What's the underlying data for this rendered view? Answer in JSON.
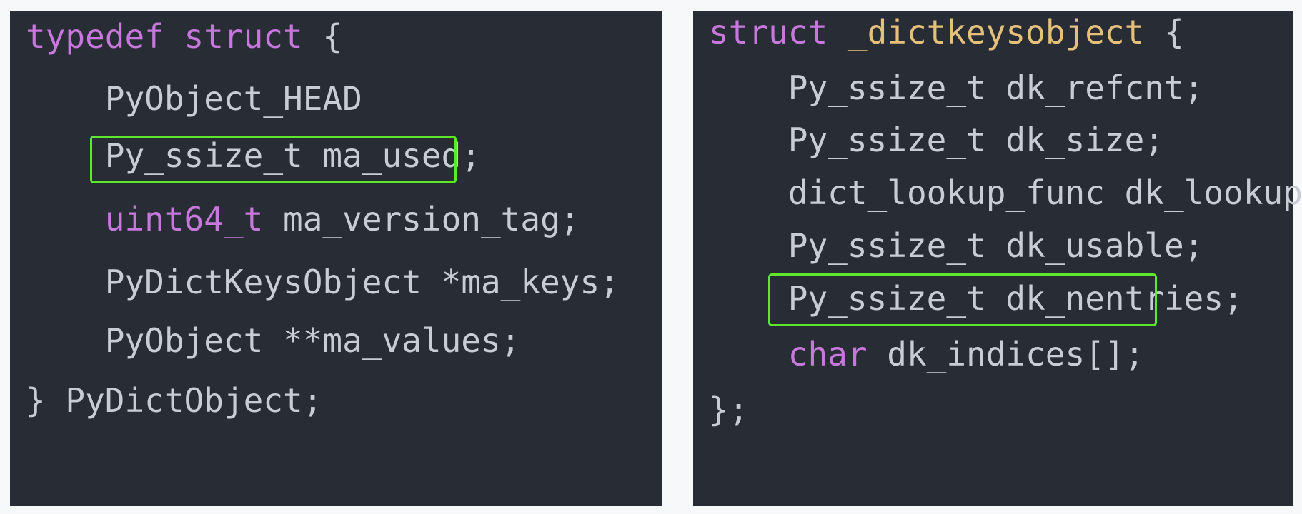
{
  "colors": {
    "page_background": "#f6f8fa",
    "panel_background": "#282c34",
    "keyword": "#c678dd",
    "struct_name": "#e5c07b",
    "plain_text": "#c8ccd4",
    "highlight_border": "#5ee82c"
  },
  "left_panel": {
    "lines": [
      {
        "tokens": [
          {
            "t": "typedef struct",
            "c": "kw"
          },
          {
            "t": " {",
            "c": "plain"
          }
        ]
      },
      {
        "tokens": [
          {
            "t": "    PyObject_HEAD",
            "c": "plain"
          }
        ]
      },
      {
        "tokens": [
          {
            "t": "    Py_ssize_t ma_used;",
            "c": "plain"
          }
        ],
        "highlighted": true
      },
      {
        "tokens": [
          {
            "t": "    ",
            "c": "plain"
          },
          {
            "t": "uint64_t",
            "c": "kw"
          },
          {
            "t": " ma_version_tag;",
            "c": "plain"
          }
        ]
      },
      {
        "tokens": [
          {
            "t": "    PyDictKeysObject *ma_keys;",
            "c": "plain"
          }
        ]
      },
      {
        "tokens": [
          {
            "t": "    PyObject **ma_values;",
            "c": "plain"
          }
        ]
      },
      {
        "tokens": [
          {
            "t": "} PyDictObject;",
            "c": "plain"
          }
        ]
      }
    ]
  },
  "right_panel": {
    "lines": [
      {
        "tokens": [
          {
            "t": "struct",
            "c": "kw"
          },
          {
            "t": " ",
            "c": "plain"
          },
          {
            "t": "_dictkeysobject",
            "c": "name"
          },
          {
            "t": " {",
            "c": "plain"
          }
        ]
      },
      {
        "tokens": [
          {
            "t": "    Py_ssize_t dk_refcnt;",
            "c": "plain"
          }
        ]
      },
      {
        "tokens": [
          {
            "t": "    Py_ssize_t dk_size;",
            "c": "plain"
          }
        ]
      },
      {
        "tokens": [
          {
            "t": "    dict_lookup_func dk_lookup;",
            "c": "plain"
          }
        ]
      },
      {
        "tokens": [
          {
            "t": "    Py_ssize_t dk_usable;",
            "c": "plain"
          }
        ]
      },
      {
        "tokens": [
          {
            "t": "    Py_ssize_t dk_nentries;",
            "c": "plain"
          }
        ],
        "highlighted": true
      },
      {
        "tokens": [
          {
            "t": "    ",
            "c": "plain"
          },
          {
            "t": "char",
            "c": "kw"
          },
          {
            "t": " dk_indices[];",
            "c": "plain"
          }
        ]
      },
      {
        "tokens": [
          {
            "t": "};",
            "c": "plain"
          }
        ]
      }
    ]
  }
}
